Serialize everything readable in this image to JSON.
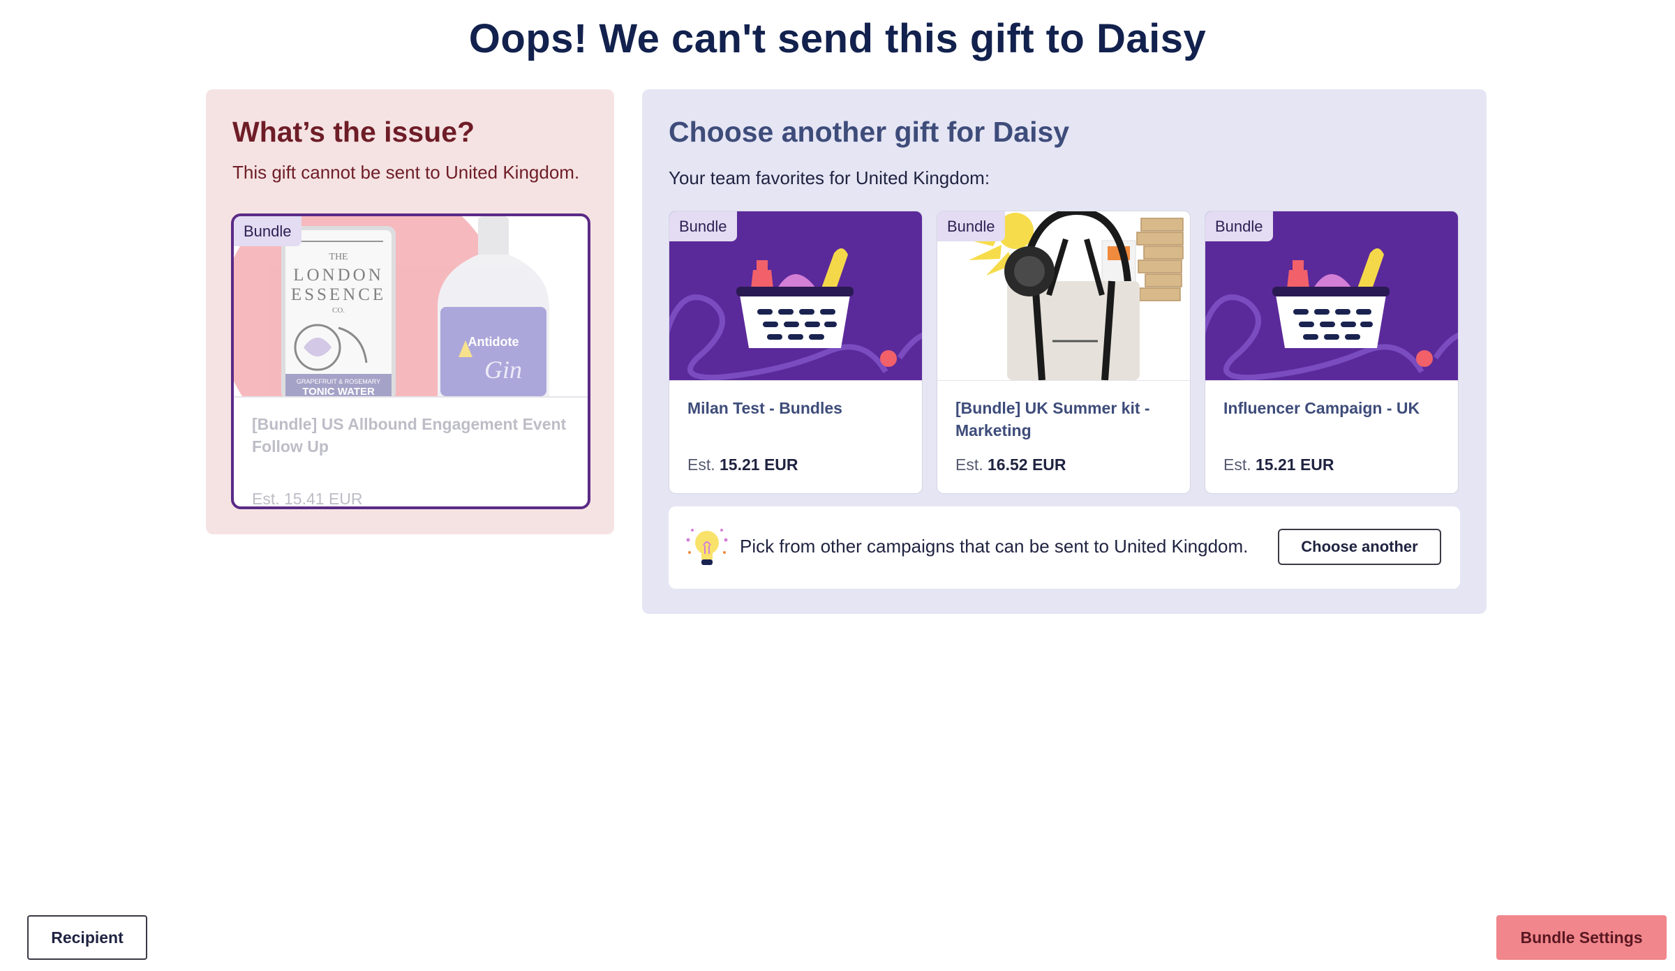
{
  "page": {
    "title": "Oops! We can't send this gift to Daisy"
  },
  "issue": {
    "heading": "What’s the issue?",
    "text": "This gift cannot be sent to United Kingdom.",
    "gift": {
      "badge": "Bundle",
      "title": "[Bundle] US Allbound Engagement Event Follow Up",
      "price": "Est. 15.41 EUR",
      "image": "tonic-water-and-gin-bottles",
      "can_text": [
        "THE",
        "LONDON",
        "ESSENCE",
        "CO.",
        "GRAPEFRUIT & ROSEMARY",
        "TONIC WATER"
      ],
      "bottle_text": [
        "Antidote",
        "Gin"
      ]
    }
  },
  "choose": {
    "heading": "Choose another gift for Daisy",
    "subtitle": "Your team favorites for United Kingdom:",
    "gifts": [
      {
        "badge": "Bundle",
        "title": "Milan Test - Bundles",
        "price_prefix": "Est.",
        "price": "15.21 EUR",
        "image": "gift-basket-illustration"
      },
      {
        "badge": "Bundle",
        "title": "[Bundle] UK Summer kit - Marketing",
        "price_prefix": "Est.",
        "price": "16.52 EUR",
        "image": "summer-tote-bag-kit"
      },
      {
        "badge": "Bundle",
        "title": "Influencer Campaign - UK",
        "price_prefix": "Est.",
        "price": "15.21 EUR",
        "image": "gift-basket-illustration"
      }
    ],
    "tip": {
      "text": "Pick from other campaigns that can be sent to United Kingdom.",
      "icon": "lightbulb-icon",
      "button_label": "Choose another"
    }
  },
  "footer": {
    "back_label": "Recipient",
    "next_label": "Bundle Settings"
  },
  "colors": {
    "title": "#12214d",
    "issue_bg": "#f5e3e3",
    "issue_text": "#6e1d27",
    "choose_bg": "#e5e5f4",
    "choose_heading": "#3e4c7a",
    "selected_border": "#5b2a86",
    "basket_bg": "#5b2a9a",
    "primary_button": "#f1878c"
  }
}
